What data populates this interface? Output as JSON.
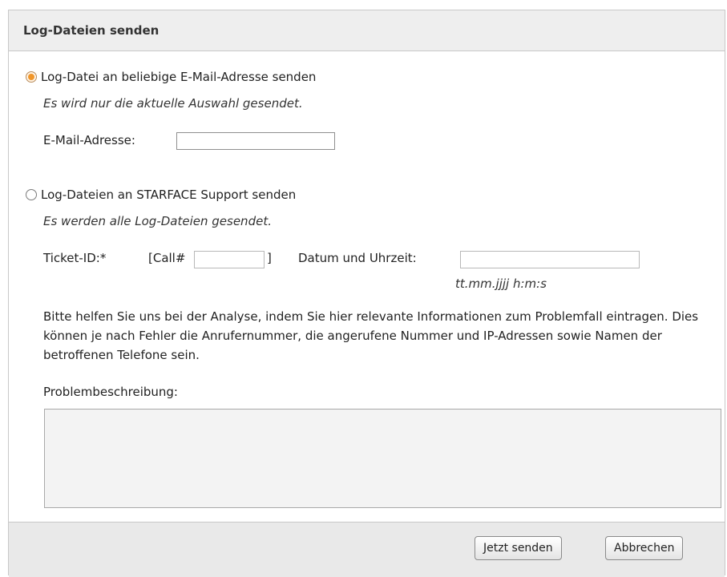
{
  "dialog": {
    "title": "Log-Dateien senden"
  },
  "option_email": {
    "label": "Log-Datei an beliebige E-Mail-Adresse senden",
    "selected": true,
    "hint": "Es wird nur die aktuelle Auswahl gesendet.",
    "email_label": "E-Mail-Adresse:",
    "email_value": ""
  },
  "option_support": {
    "label": "Log-Dateien an STARFACE Support senden",
    "selected": false,
    "hint": "Es werden alle Log-Dateien gesendet.",
    "ticket_label": "Ticket-ID:*",
    "call_prefix": "[Call#",
    "call_suffix": "]",
    "ticket_value": "",
    "datetime_label": "Datum und Uhrzeit:",
    "datetime_value": "",
    "datetime_format": "tt.mm.jjjj h:m:s",
    "help_text": "Bitte helfen Sie uns bei der Analyse, indem Sie hier relevante Informationen zum Problemfall eintragen. Dies können je nach Fehler die Anrufernummer, die angerufene Nummer und IP-Adressen sowie Namen der betroffenen Telefone sein.",
    "problem_label": "Problembeschreibung:",
    "problem_value": ""
  },
  "footer": {
    "send_label": "Jetzt senden",
    "cancel_label": "Abbrechen"
  },
  "colors": {
    "radio_accent": "#f0962a",
    "header_bg": "#eeeeee",
    "footer_bg": "#e9e9e9"
  }
}
